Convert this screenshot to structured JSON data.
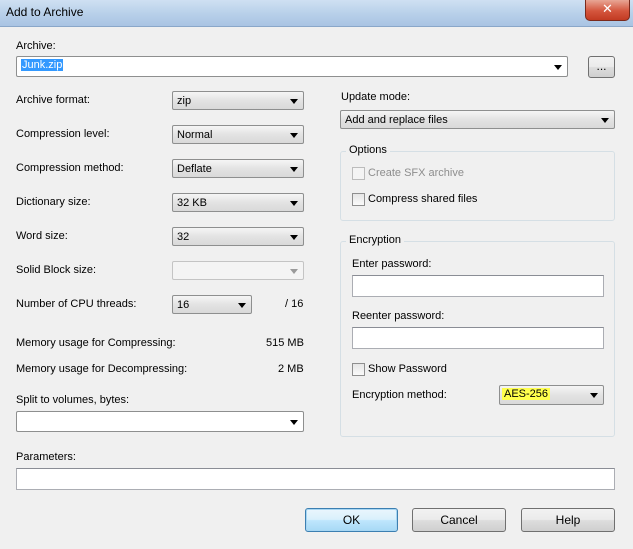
{
  "window": {
    "title": "Add to Archive",
    "close_glyph": "✕"
  },
  "archive": {
    "label": "Archive:",
    "value": "Junk.zip",
    "browse_label": "..."
  },
  "left": {
    "archive_format": {
      "label": "Archive format:",
      "value": "zip"
    },
    "compression_level": {
      "label": "Compression level:",
      "value": "Normal"
    },
    "compression_method": {
      "label": "Compression method:",
      "value": "Deflate"
    },
    "dictionary_size": {
      "label": "Dictionary size:",
      "value": "32 KB"
    },
    "word_size": {
      "label": "Word size:",
      "value": "32"
    },
    "solid_block_size": {
      "label": "Solid Block size:",
      "value": ""
    },
    "cpu_threads": {
      "label": "Number of CPU threads:",
      "value": "16",
      "max": "/ 16"
    },
    "memory_compress": {
      "label": "Memory usage for Compressing:",
      "value": "515 MB"
    },
    "memory_decompress": {
      "label": "Memory usage for Decompressing:",
      "value": "2 MB"
    },
    "split": {
      "label": "Split to volumes, bytes:",
      "value": ""
    }
  },
  "right": {
    "update_mode": {
      "label": "Update mode:",
      "value": "Add and replace files"
    },
    "options": {
      "title": "Options",
      "sfx": {
        "label": "Create SFX archive",
        "checked": false,
        "enabled": false
      },
      "shared": {
        "label": "Compress shared files",
        "checked": false,
        "enabled": true
      }
    },
    "encryption": {
      "title": "Encryption",
      "enter_password": {
        "label": "Enter password:",
        "value": ""
      },
      "reenter_password": {
        "label": "Reenter password:",
        "value": ""
      },
      "show_password": {
        "label": "Show Password",
        "checked": false
      },
      "method": {
        "label": "Encryption method:",
        "value": "AES-256",
        "highlight_color": "#ffff4d"
      }
    }
  },
  "parameters": {
    "label": "Parameters:",
    "value": ""
  },
  "buttons": {
    "ok": "OK",
    "cancel": "Cancel",
    "help": "Help"
  }
}
